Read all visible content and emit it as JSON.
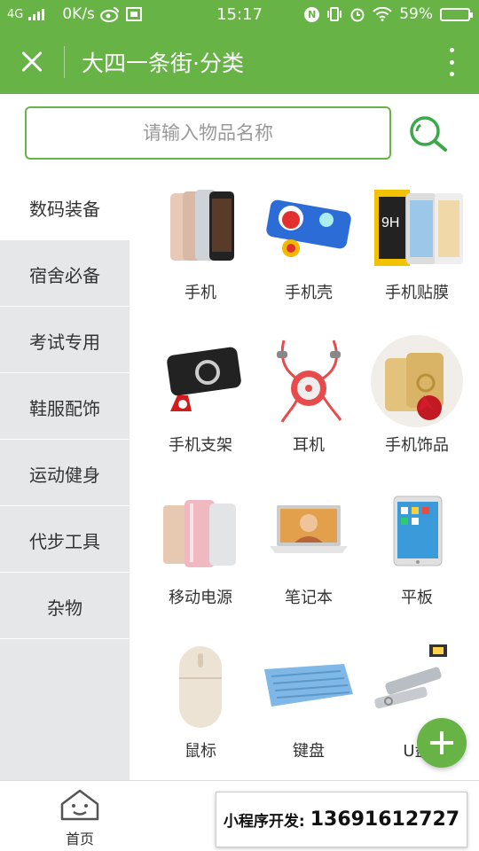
{
  "status_bar": {
    "network": "4G",
    "speed": "0K/s",
    "time": "15:17",
    "nfc": "N",
    "battery": "59%",
    "battery_level": 0.59
  },
  "header": {
    "title": "大四一条街·分类",
    "color": "#67b346"
  },
  "search": {
    "placeholder": "请输入物品名称"
  },
  "sidebar": {
    "items": [
      {
        "label": "数码装备",
        "active": true
      },
      {
        "label": "宿舍必备",
        "active": false
      },
      {
        "label": "考试专用",
        "active": false
      },
      {
        "label": "鞋服配饰",
        "active": false
      },
      {
        "label": "运动健身",
        "active": false
      },
      {
        "label": "代步工具",
        "active": false
      },
      {
        "label": "杂物",
        "active": false
      }
    ]
  },
  "products": [
    {
      "label": "手机",
      "icon": "phone-image"
    },
    {
      "label": "手机壳",
      "icon": "phone-case-image"
    },
    {
      "label": "手机贴膜",
      "icon": "screen-protector-image"
    },
    {
      "label": "手机支架",
      "icon": "phone-holder-image"
    },
    {
      "label": "耳机",
      "icon": "earphones-image"
    },
    {
      "label": "手机饰品",
      "icon": "phone-accessory-image"
    },
    {
      "label": "移动电源",
      "icon": "power-bank-image"
    },
    {
      "label": "笔记本",
      "icon": "laptop-image"
    },
    {
      "label": "平板",
      "icon": "tablet-image"
    },
    {
      "label": "鼠标",
      "icon": "mouse-image"
    },
    {
      "label": "键盘",
      "icon": "keyboard-image"
    },
    {
      "label": "U盘",
      "icon": "usb-drive-image"
    }
  ],
  "tabbar": {
    "home_label": "首页"
  },
  "promo": {
    "label": "小程序开发:",
    "phone": "13691612727"
  }
}
